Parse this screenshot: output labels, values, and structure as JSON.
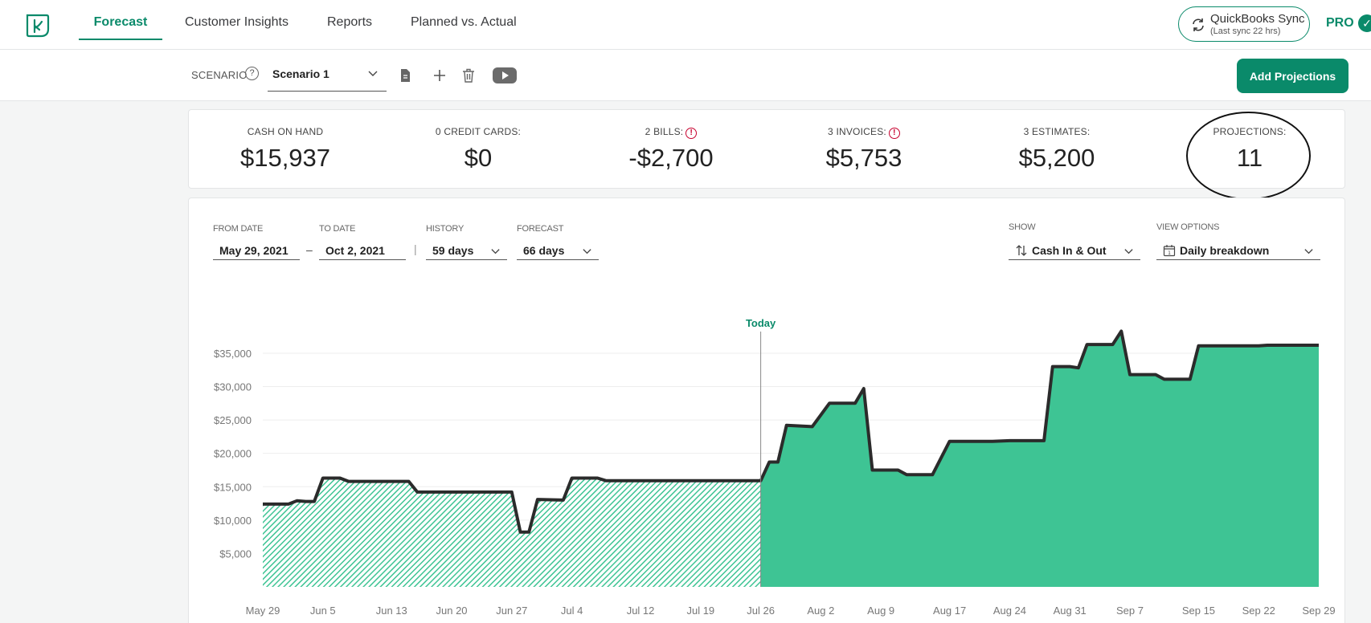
{
  "nav": {
    "tabs": [
      {
        "label": "Forecast",
        "active": true
      },
      {
        "label": "Customer Insights"
      },
      {
        "label": "Reports"
      },
      {
        "label": "Planned vs. Actual"
      }
    ],
    "sync_title": "QuickBooks Sync",
    "sync_sub": "(Last sync 22 hrs)",
    "pro_label": "PRO"
  },
  "scenario": {
    "label": "SCENARIO",
    "selected": "Scenario 1",
    "add_projections": "Add Projections"
  },
  "summary": [
    {
      "label": "CASH ON HAND",
      "value": "$15,937",
      "warning": false
    },
    {
      "label": "0 CREDIT CARDS:",
      "value": "$0",
      "warning": false
    },
    {
      "label": "2 BILLS:",
      "value": "-$2,700",
      "warning": true
    },
    {
      "label": "3 INVOICES:",
      "value": "$5,753",
      "warning": true
    },
    {
      "label": "3 ESTIMATES:",
      "value": "$5,200",
      "warning": false
    },
    {
      "label": "PROJECTIONS:",
      "value": "11",
      "warning": false
    }
  ],
  "filters": {
    "from_label": "FROM DATE",
    "from_value": "May 29, 2021",
    "to_label": "TO DATE",
    "to_value": "Oct 2, 2021",
    "dash": "–",
    "sep": "|",
    "history_label": "HISTORY",
    "history_value": "59 days",
    "forecast_label": "FORECAST",
    "forecast_value": "66 days",
    "show_label": "SHOW",
    "show_value": "Cash In & Out",
    "view_label": "VIEW OPTIONS",
    "view_value": "Daily breakdown"
  },
  "colors": {
    "brand": "#0a8a6a",
    "area": "#3ec494",
    "line": "#2b2b2b",
    "warning": "#c7002e"
  },
  "chart_data": {
    "type": "area",
    "today_label": "Today",
    "today_index": 58,
    "ylim": [
      0,
      38000
    ],
    "y_ticks": [
      5000,
      10000,
      15000,
      20000,
      25000,
      30000,
      35000
    ],
    "y_tick_labels": [
      "$5,000",
      "$10,000",
      "$15,000",
      "$20,000",
      "$25,000",
      "$30,000",
      "$35,000"
    ],
    "x_tick_labels": [
      "May 29",
      "Jun 5",
      "Jun 13",
      "Jun 20",
      "Jun 27",
      "Jul 4",
      "Jul 12",
      "Jul 19",
      "Jul 26",
      "Aug 2",
      "Aug 9",
      "Aug 17",
      "Aug 24",
      "Aug 31",
      "Sep 7",
      "Sep 15",
      "Sep 22",
      "Sep 29"
    ],
    "x_tick_index": [
      0,
      7,
      15,
      22,
      29,
      36,
      44,
      51,
      58,
      65,
      72,
      80,
      87,
      94,
      101,
      109,
      116,
      123
    ],
    "series": [
      {
        "values": [
          [
            0,
            12400
          ],
          [
            3,
            12400
          ],
          [
            4,
            12900
          ],
          [
            5,
            12800
          ],
          [
            6,
            12800
          ],
          [
            7,
            16300
          ],
          [
            9,
            16300
          ],
          [
            10,
            15800
          ],
          [
            17,
            15800
          ],
          [
            18,
            14200
          ],
          [
            29,
            14200
          ],
          [
            30,
            8200
          ],
          [
            31,
            8200
          ],
          [
            32,
            13100
          ],
          [
            35,
            13000
          ],
          [
            36,
            16300
          ],
          [
            39,
            16300
          ],
          [
            40,
            15900
          ],
          [
            58,
            15900
          ],
          [
            59,
            18700
          ],
          [
            60,
            18700
          ],
          [
            61,
            24200
          ],
          [
            64,
            24000
          ],
          [
            66,
            27500
          ],
          [
            69,
            27500
          ],
          [
            70,
            29700
          ],
          [
            71,
            17500
          ],
          [
            74,
            17500
          ],
          [
            75,
            16800
          ],
          [
            78,
            16800
          ],
          [
            80,
            21800
          ],
          [
            85,
            21800
          ],
          [
            87,
            21900
          ],
          [
            91,
            21900
          ],
          [
            92,
            33000
          ],
          [
            94,
            33000
          ],
          [
            95,
            32800
          ],
          [
            96,
            36300
          ],
          [
            99,
            36300
          ],
          [
            100,
            38300
          ],
          [
            101,
            31800
          ],
          [
            104,
            31800
          ],
          [
            105,
            31100
          ],
          [
            108,
            31100
          ],
          [
            109,
            36100
          ],
          [
            116,
            36100
          ],
          [
            117,
            36200
          ],
          [
            123,
            36200
          ]
        ]
      }
    ]
  }
}
